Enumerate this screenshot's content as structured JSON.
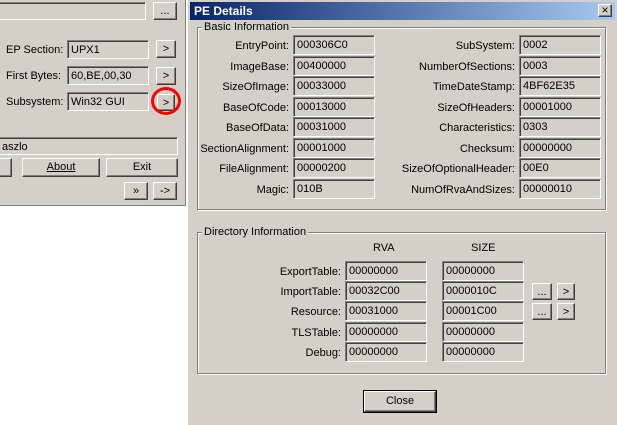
{
  "main_window": {
    "ep_section_label": "EP Section:",
    "ep_section_value": "UPX1",
    "first_bytes_label": "First Bytes:",
    "first_bytes_value": "60,BE,00,30",
    "subsystem_label": "Subsystem:",
    "subsystem_value": "Win32 GUI",
    "browse_label": "...",
    "arrow_label": ">",
    "bottom_text": "aszlo",
    "about_label": "About",
    "exit_label": "Exit",
    "more_label": "»",
    "next_label": "->"
  },
  "dialog": {
    "title": "PE Details",
    "close_x": "×",
    "basic_group_title": "Basic Information",
    "basic_left": [
      {
        "label": "EntryPoint:",
        "value": "000306C0"
      },
      {
        "label": "ImageBase:",
        "value": "00400000"
      },
      {
        "label": "SizeOfImage:",
        "value": "00033000"
      },
      {
        "label": "BaseOfCode:",
        "value": "00013000"
      },
      {
        "label": "BaseOfData:",
        "value": "00031000"
      },
      {
        "label": "SectionAlignment:",
        "value": "00001000"
      },
      {
        "label": "FileAlignment:",
        "value": "00000200"
      },
      {
        "label": "Magic:",
        "value": "010B"
      }
    ],
    "basic_right": [
      {
        "label": "SubSystem:",
        "value": "0002"
      },
      {
        "label": "NumberOfSections:",
        "value": "0003"
      },
      {
        "label": "TimeDateStamp:",
        "value": "4BF62E35"
      },
      {
        "label": "SizeOfHeaders:",
        "value": "00001000"
      },
      {
        "label": "Characteristics:",
        "value": "0303"
      },
      {
        "label": "Checksum:",
        "value": "00000000"
      },
      {
        "label": "SizeOfOptionalHeader:",
        "value": "00E0"
      },
      {
        "label": "NumOfRvaAndSizes:",
        "value": "00000010"
      }
    ],
    "dir_group_title": "Directory Information",
    "rva_header": "RVA",
    "size_header": "SIZE",
    "directories": [
      {
        "label": "ExportTable:",
        "rva": "00000000",
        "size": "00000000"
      },
      {
        "label": "ImportTable:",
        "rva": "00032C00",
        "size": "0000010C"
      },
      {
        "label": "Resource:",
        "rva": "00031000",
        "size": "00001C00"
      },
      {
        "label": "TLSTable:",
        "rva": "00000000",
        "size": "00000000"
      },
      {
        "label": "Debug:",
        "rva": "00000000",
        "size": "00000000"
      }
    ],
    "dots_label": "...",
    "arrow_label": ">",
    "close_button_label": "Close"
  }
}
